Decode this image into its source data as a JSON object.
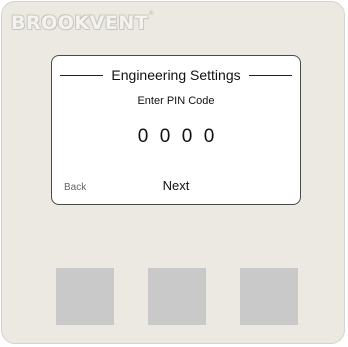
{
  "brand": {
    "name": "BROOKVENT",
    "trademark": "®"
  },
  "screen": {
    "title": "Engineering Settings",
    "prompt": "Enter PIN Code",
    "pin_digits": [
      "0",
      "0",
      "0",
      "0"
    ],
    "back_label": "Back",
    "next_label": "Next"
  },
  "buttons": [
    {
      "name": "left"
    },
    {
      "name": "middle"
    },
    {
      "name": "right"
    }
  ],
  "colors": {
    "panel": "#ece9e2",
    "screen": "#ffffff",
    "button": "#c9c9c9",
    "text": "#111111"
  }
}
